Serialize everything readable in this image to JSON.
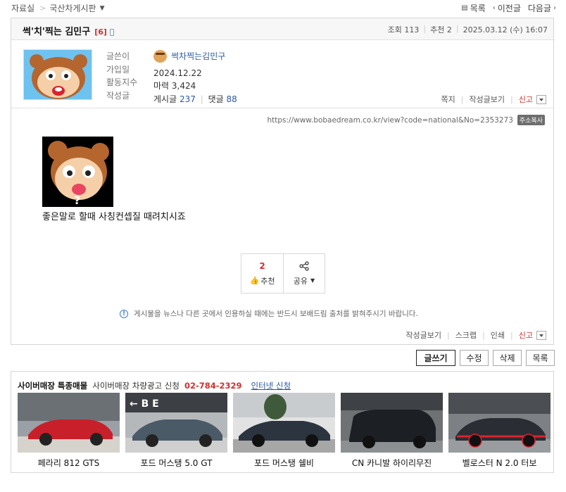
{
  "breadcrumb": {
    "root": "자료실",
    "board": "국산차게시판"
  },
  "topnav": {
    "list": "목록",
    "prev": "이전글",
    "next": "다음글"
  },
  "post": {
    "title": "썩'치'찍는 김민구",
    "comment_count": "[6]",
    "views_label": "조회",
    "views": "113",
    "recommend_label": "추천",
    "recommend": "2",
    "date": "2025.03.12 (수) 16:07"
  },
  "author": {
    "labels": [
      "글쓴이",
      "가입일",
      "활동지수",
      "작성글"
    ],
    "nickname": "썩차찍는김민구",
    "joined": "2024.12.22",
    "activity": "마력 3,424",
    "posts_label": "게시글",
    "posts": "237",
    "comments_label": "댓글",
    "comments": "88",
    "actions": [
      "쪽지",
      "작성글보기",
      "신고"
    ]
  },
  "body": {
    "url": "https://www.bobaedream.co.kr/view?code=national&No=2353273",
    "copy_label": "주소복사",
    "text": "좋은말로 할때 사칭컨셉질 때려치시죠",
    "vote_count": "2",
    "vote_label": "추천",
    "share_label": "공유",
    "notice": "게시물을 뉴스나 다른 곳에서 인용하실 때에는 반드시 보배드림 출처를 밝혀주시기 바랍니다.",
    "bottom_actions": [
      "작성글보기",
      "스크랩",
      "인쇄",
      "신고"
    ]
  },
  "buttons": [
    "글쓰기",
    "수정",
    "삭제",
    "목록"
  ],
  "market": {
    "title": "사이버매장 특종매물",
    "ad_label": "사이버매장 차량광고 신청",
    "phone": "02-784-2329",
    "web_link": "인터넷 신청",
    "cars": [
      {
        "name": "페라리 812 GTS",
        "color": "#c8202a"
      },
      {
        "name": "포드 머스탱 5.0 GT",
        "color": "#4a5a66"
      },
      {
        "name": "포드 머스탱 쉘비",
        "color": "#2c3440"
      },
      {
        "name": "CN 카니발 하이리무진",
        "color": "#1c1f24"
      },
      {
        "name": "벨로스터 N 2.0 터보",
        "color": "#2a2d33"
      }
    ]
  },
  "colors": {
    "accent_red": "#d32f2f",
    "link_blue": "#2a58a8"
  }
}
